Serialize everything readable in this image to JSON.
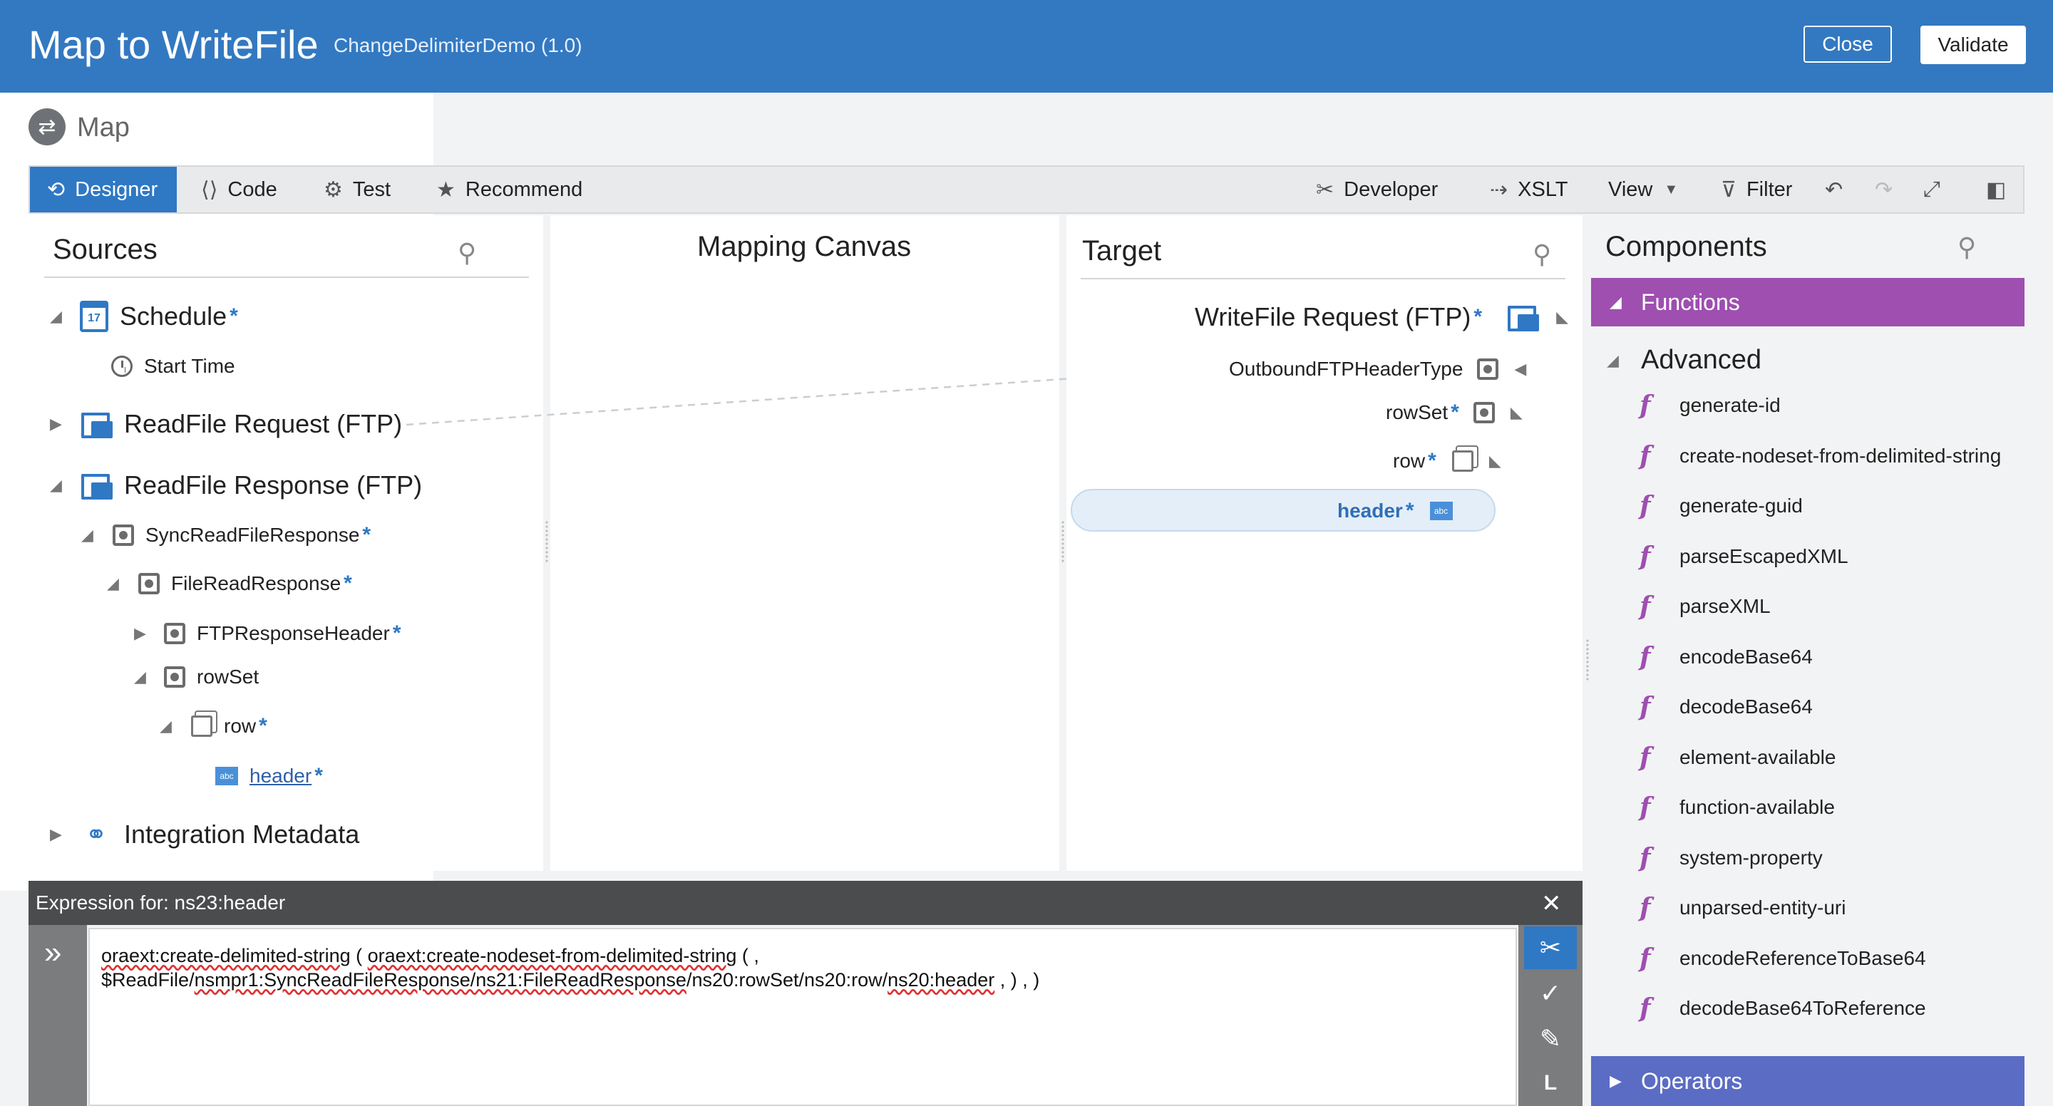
{
  "header": {
    "title": "Map to WriteFile",
    "subtitle": "ChangeDelimiterDemo (1.0)",
    "close_label": "Close",
    "validate_label": "Validate"
  },
  "subheader": {
    "label": "Map"
  },
  "toolbar": {
    "designer": "Designer",
    "code": "Code",
    "test": "Test",
    "recommend": "Recommend",
    "developer": "Developer",
    "xslt": "XSLT",
    "view": "View",
    "filter": "Filter"
  },
  "sources": {
    "title": "Sources",
    "items": [
      {
        "label": "Schedule",
        "required": "*"
      },
      {
        "label": "Start Time"
      },
      {
        "label": "ReadFile Request (FTP)"
      },
      {
        "label": "ReadFile Response (FTP)"
      },
      {
        "label": "SyncReadFileResponse",
        "required": "*"
      },
      {
        "label": "FileReadResponse",
        "required": "*"
      },
      {
        "label": "FTPResponseHeader",
        "required": "*"
      },
      {
        "label": "rowSet"
      },
      {
        "label": "row",
        "required": "*"
      },
      {
        "label": "header",
        "required": "*"
      },
      {
        "label": "Integration Metadata"
      }
    ],
    "calendar_day": "17"
  },
  "canvas": {
    "title": "Mapping Canvas"
  },
  "target": {
    "title": "Target",
    "items": [
      {
        "label": "WriteFile Request (FTP)",
        "required": "*"
      },
      {
        "label": "OutboundFTPHeaderType"
      },
      {
        "label": "rowSet",
        "required": "*"
      },
      {
        "label": "row",
        "required": "*"
      },
      {
        "label": "header",
        "required": "*"
      }
    ]
  },
  "components": {
    "title": "Components",
    "functions_label": "Functions",
    "advanced_label": "Advanced",
    "functions": [
      "generate-id",
      "create-nodeset-from-delimited-string",
      "generate-guid",
      "parseEscapedXML",
      "parseXML",
      "encodeBase64",
      "decodeBase64",
      "element-available",
      "function-available",
      "system-property",
      "unparsed-entity-uri",
      "encodeReferenceToBase64",
      "decodeBase64ToReference"
    ],
    "operators_label": "Operators"
  },
  "expression": {
    "header": "Expression for: ns23:header",
    "line1_a": "oraext:create-delimited-string",
    "line1_b": " ( ",
    "line1_c": "oraext:create-nodeset-from-delimited-string",
    "line1_d": " ( ,",
    "line2_a": "$ReadFile/",
    "line2_b": "nsmpr1:SyncReadFileResponse/ns21:FileReadResponse",
    "line2_c": "/ns20:rowSet/ns20:row/",
    "line2_d": "ns20:header",
    "line2_e": " , ) , )"
  },
  "colors": {
    "header_blue": "#3379c1",
    "functions_purple": "#9e4fb0",
    "operators_blue": "#5b6cc4",
    "accent": "#2f78c4"
  }
}
